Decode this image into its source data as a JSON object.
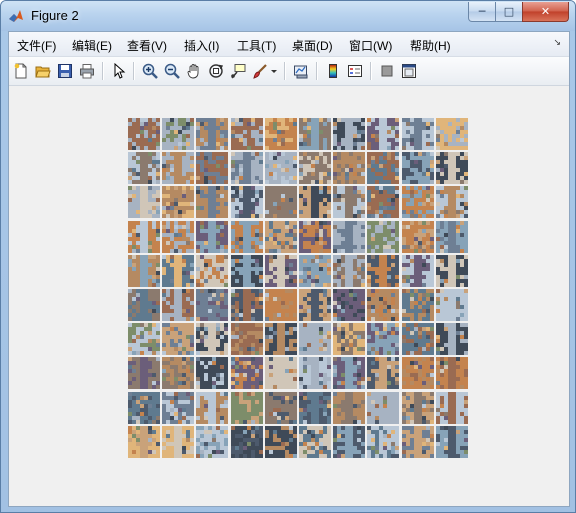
{
  "window": {
    "title": "Figure 2",
    "controls": {
      "minimize": "─",
      "maximize": "□",
      "close": "✕"
    }
  },
  "menubar": {
    "items": [
      "文件(F)",
      "编辑(E)",
      "查看(V)",
      "插入(I)",
      "工具(T)",
      "桌面(D)",
      "窗口(W)",
      "帮助(H)"
    ],
    "overflow_arrow": "↘"
  },
  "toolbar": {
    "buttons": [
      {
        "name": "new-figure-icon"
      },
      {
        "name": "open-file-icon"
      },
      {
        "name": "save-icon"
      },
      {
        "name": "print-icon"
      },
      {
        "name": "edit-plot-arrow-icon"
      },
      {
        "name": "zoom-in-icon"
      },
      {
        "name": "zoom-out-icon"
      },
      {
        "name": "pan-hand-icon"
      },
      {
        "name": "rotate-3d-icon"
      },
      {
        "name": "data-cursor-icon"
      },
      {
        "name": "brush-icon"
      },
      {
        "name": "brush-dropdown-icon"
      },
      {
        "name": "link-plot-icon"
      },
      {
        "name": "colorbar-icon"
      },
      {
        "name": "legend-icon"
      },
      {
        "name": "hide-plot-tools-icon"
      },
      {
        "name": "show-plot-tools-icon"
      }
    ]
  },
  "figure": {
    "content": "grid of image patches",
    "rows": 10,
    "cols": 10,
    "palette": [
      "#8b7a6e",
      "#6e7f94",
      "#b58a62",
      "#4d5a6c",
      "#a7b3c2",
      "#c9a27a",
      "#5f7a8f",
      "#7d8d6a",
      "#d0c6b8",
      "#3f4a58",
      "#9a6b52",
      "#b9c7d6",
      "#e0b57a",
      "#6b5e7a",
      "#87a3b8",
      "#c4834e"
    ]
  }
}
